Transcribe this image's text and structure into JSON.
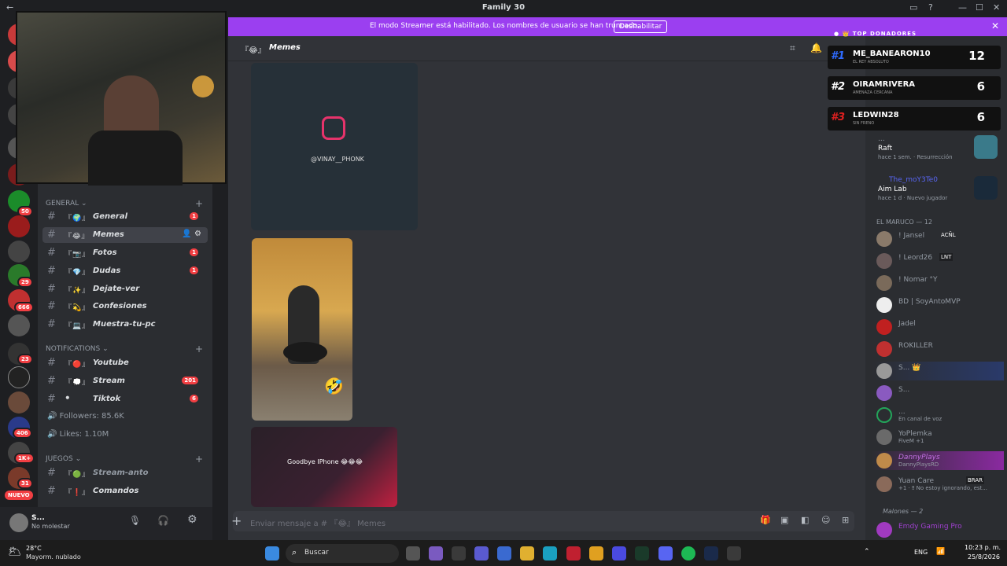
{
  "window": {
    "title": "Family 30"
  },
  "banner": {
    "message": "El modo Streamer está habilitado. Los nombres de usuario se han truncado.",
    "button": "Deshabilitar"
  },
  "rail": {
    "new_label": "NUEVO",
    "badges": [
      "29",
      "666",
      "50",
      "23",
      "406",
      "1K+",
      "31"
    ]
  },
  "categories": {
    "general": "GENERAL",
    "notifications": "NOTIFICATIONS",
    "juegos": "JUEGOS"
  },
  "channels": [
    {
      "emoji": "『🌍』",
      "name": "General",
      "count": "1"
    },
    {
      "emoji": "『😂』",
      "name": "Memes",
      "count": ""
    },
    {
      "emoji": "『📷』",
      "name": "Fotos",
      "count": "1"
    },
    {
      "emoji": "『💎』",
      "name": "Dudas",
      "count": "1"
    },
    {
      "emoji": "『✨』",
      "name": "Dejate-ver",
      "count": ""
    },
    {
      "emoji": "『💫』",
      "name": "Confesiones",
      "count": ""
    },
    {
      "emoji": "『💻』",
      "name": "Muestra-tu-pc",
      "count": ""
    },
    {
      "emoji": "『🔴』",
      "name": "Youtube",
      "count": ""
    },
    {
      "emoji": "『💭』",
      "name": "Stream",
      "count": "201"
    },
    {
      "emoji": "⚫",
      "name": "Tiktok",
      "count": "6"
    },
    {
      "emoji": "『🟢』",
      "name": "Stream-anto",
      "count": ""
    },
    {
      "emoji": "『❗』",
      "name": "Comandos",
      "count": ""
    }
  ],
  "voice": {
    "followers": "Followers: 85.6K",
    "likes": "Likes: 1.10M"
  },
  "user": {
    "name": "S...",
    "status": "No molestar"
  },
  "header": {
    "channel": "Memes",
    "emoji": "『😂』"
  },
  "media": {
    "watermark": "@VINAY__PHONK",
    "caption": "Goodbye IPhone 😂😂😂"
  },
  "input": {
    "placeholder": "Enviar mensaje a # 『😂』 Memes"
  },
  "activity": [
    {
      "game": "Raft",
      "time": "hace 1 sem.",
      "tag": "Resurrección",
      "user": "..."
    },
    {
      "game": "Aim Lab",
      "time": "hace 1 d",
      "tag": "Nuevo jugador",
      "user": "The_moY3Te0"
    }
  ],
  "member_group": "EL MARUCO — 12",
  "members": [
    {
      "name": "! Jansel",
      "tag": "ACÑL",
      "sub": ""
    },
    {
      "name": "! Leord26",
      "tag": "LNT",
      "sub": ""
    },
    {
      "name": "! Nomar °Y",
      "tag": "",
      "sub": ""
    },
    {
      "name": "BD | SoyAntoMVP",
      "tag": "",
      "sub": ""
    },
    {
      "name": "Jadel",
      "tag": "",
      "sub": ""
    },
    {
      "name": "ROKILLER",
      "tag": "",
      "sub": ""
    },
    {
      "name": "S... 👑",
      "tag": "",
      "sub": ""
    },
    {
      "name": "S...",
      "tag": "",
      "sub": ""
    },
    {
      "name": "...",
      "tag": "",
      "sub": "En canal de voz"
    },
    {
      "name": "YoPlemka",
      "tag": "",
      "sub": "FiveM +1"
    },
    {
      "name": "DannyPlays",
      "tag": "",
      "sub": "DannyPlaysRD"
    },
    {
      "name": "Yuan Care",
      "tag": "BRAR",
      "sub": "+1 · ‼ No estoy ignorando, est..."
    }
  ],
  "member_group2": "Malones — 2",
  "members2": [
    {
      "name": "Emdy Gaming Pro"
    }
  ],
  "donors": {
    "title": "TOP DONADORES",
    "list": [
      {
        "rank": "#1",
        "name": "ME_BANEARON10",
        "sub": "EL REY ABSOLUTO",
        "count": "12",
        "color": "#2f6bff"
      },
      {
        "rank": "#2",
        "name": "OIRAMRIVERA",
        "sub": "AMENAZA CERCANA",
        "count": "6",
        "color": "#ffffff"
      },
      {
        "rank": "#3",
        "name": "LEDWIN28",
        "sub": "SIN FRENO",
        "count": "6",
        "color": "#e02020"
      }
    ]
  },
  "taskbar": {
    "weather_temp": "28°C",
    "weather_desc": "Mayorm. nublado",
    "search": "Buscar",
    "lang": "ENG",
    "time": "10:23 p. m.",
    "date": "25/8/2026"
  }
}
